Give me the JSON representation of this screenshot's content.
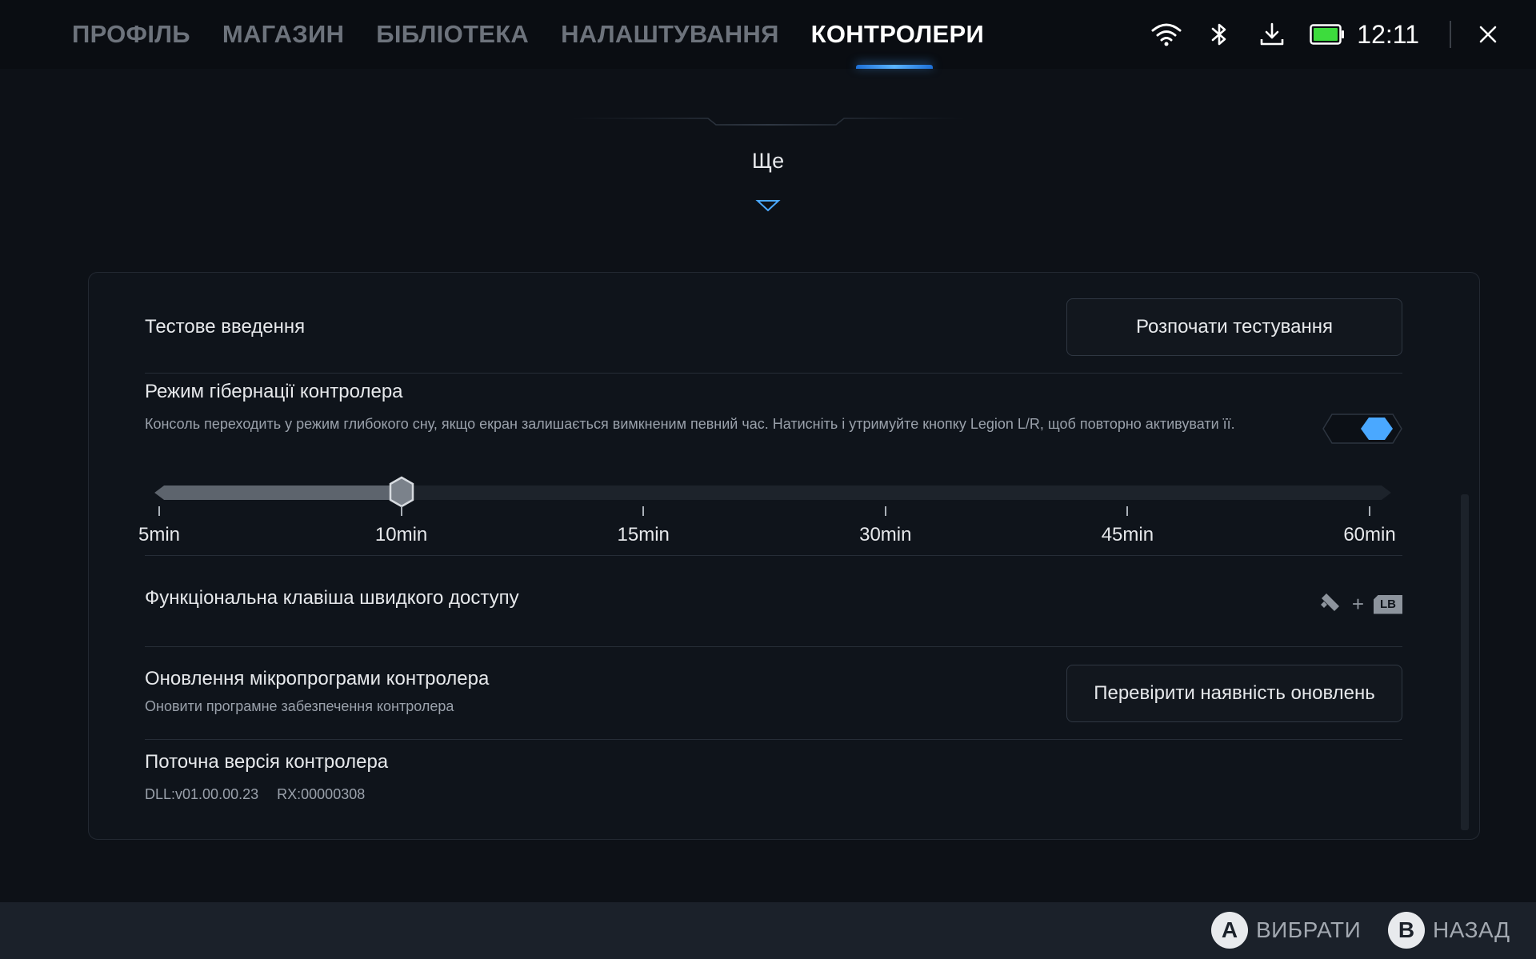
{
  "nav": {
    "tabs": [
      {
        "label": "ПРОФІЛЬ"
      },
      {
        "label": "МАГАЗИН"
      },
      {
        "label": "БІБЛІОТЕКА"
      },
      {
        "label": "НАЛАШТУВАННЯ"
      },
      {
        "label": "КОНТРОЛЕРИ"
      }
    ],
    "active_tab": "КОНТРОЛЕРИ"
  },
  "status": {
    "icons": [
      "wifi-icon",
      "bluetooth-icon",
      "download-icon",
      "battery-icon"
    ],
    "time": "12:11",
    "battery_color": "#3ddc3d"
  },
  "more": {
    "label": "Ще"
  },
  "settings": {
    "test_input": {
      "label": "Тестове введення",
      "button": "Розпочати тестування"
    },
    "hibernation": {
      "label": "Режим гібернації контролера",
      "description": "Консоль переходить у режим глибокого сну, якщо екран залишається вимкненим певний час. Натисніть і утримуйте кнопку Legion L/R, щоб повторно активувати її.",
      "enabled": true,
      "slider": {
        "ticks": [
          "5min",
          "10min",
          "15min",
          "30min",
          "45min",
          "60min"
        ],
        "selected": "10min"
      }
    },
    "shortcut": {
      "label": "Функціональна клавіша швидкого доступу",
      "plus": "+",
      "key": "LB"
    },
    "firmware": {
      "label": "Оновлення мікропрограми контролера",
      "sublabel": "Оновити програмне забезпечення контролера",
      "button": "Перевірити наявність оновлень"
    },
    "version": {
      "label": "Поточна версія контролера",
      "dll": "DLL:v01.00.00.23",
      "rx": "RX:00000308"
    }
  },
  "footer": {
    "select": {
      "key": "A",
      "label": "ВИБРАТИ"
    },
    "back": {
      "key": "B",
      "label": "НАЗАД"
    }
  },
  "colors": {
    "accent": "#4aa8ff",
    "background": "#0d1117"
  }
}
